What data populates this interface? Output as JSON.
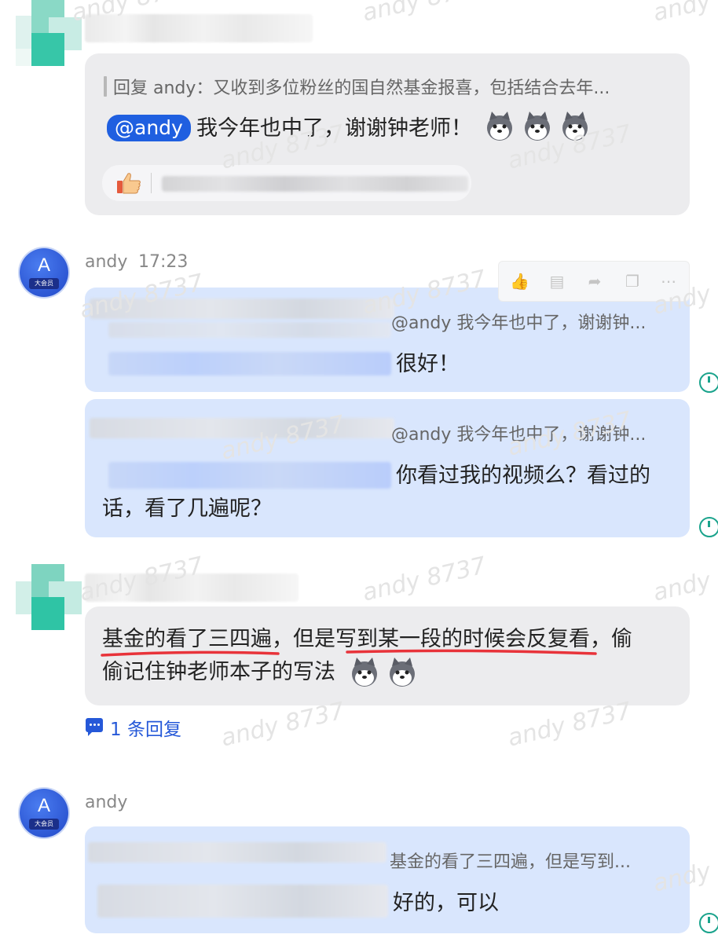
{
  "watermark": "andy 8737",
  "comment1": {
    "quote": "回复 andy：又收到多位粉丝的国自然基金报喜，包括结合去年...",
    "mention": "@andy",
    "text": "我今年也中了，谢谢钟老师！",
    "emoji": "husky-emoji"
  },
  "reply1": {
    "username": "andy",
    "time": "17:23",
    "avatar_letter": "A",
    "avatar_badge": "大会员",
    "bubble1_quote": "@andy 我今年也中了，谢谢钟...",
    "bubble1_text": "很好！",
    "bubble2_quote": "@andy 我今年也中了，谢谢钟...",
    "bubble2_line1": "你看过我的视频么？看过的",
    "bubble2_line2": "话，看了几遍呢？"
  },
  "comment2": {
    "text_a": "基金的看了三四遍",
    "text_b": "，但是",
    "text_c": "写到某一段的时候会反复看",
    "text_d": "，偷",
    "text_line2": "偷记住钟老师本子的写法",
    "underline_color": "#e8333a",
    "reply_count": "1 条回复"
  },
  "reply2": {
    "username": "andy",
    "avatar_letter": "A",
    "avatar_badge": "大会员",
    "quote": "基金的看了三四遍，但是写到...",
    "text": "好的，可以"
  },
  "colors": {
    "accent_blue": "#1f5fe0",
    "bubble_blue": "#d9e6fd",
    "bubble_gray": "#ececee",
    "teal": "#1aa38c"
  }
}
